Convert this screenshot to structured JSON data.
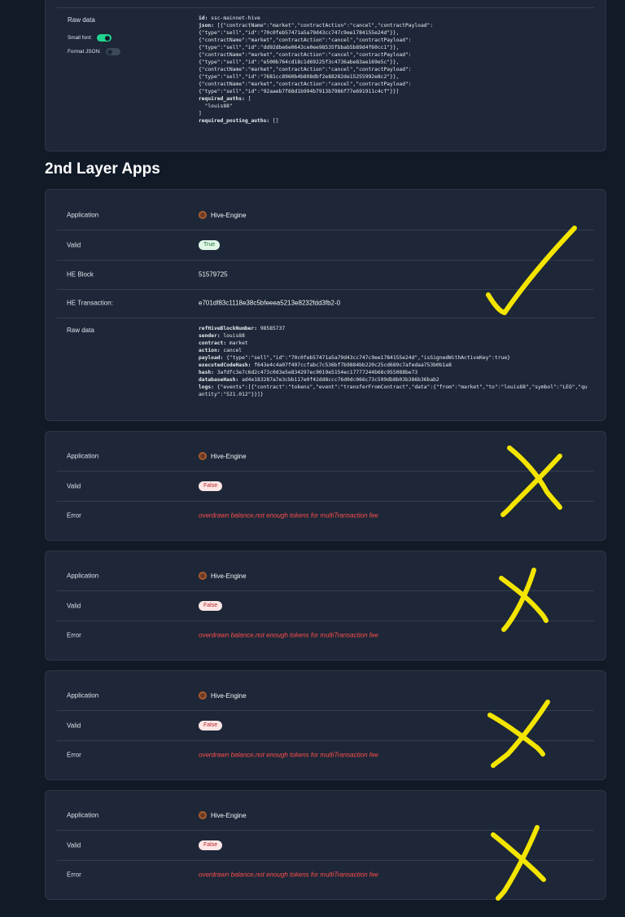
{
  "top": {
    "raw_label": "Raw data",
    "small_font_label": "Small font:",
    "format_json_label": "Format JSON:",
    "json_lines": [
      {
        "k": "id:",
        "v": " ssc-mainnet-hive"
      },
      {
        "k": "json:",
        "v": " [{\"contractName\":\"market\",\"contractAction\":\"cancel\",\"contractPayload\":"
      },
      {
        "k": "",
        "v": "{\"type\":\"sell\",\"id\":\"70c0feb57471a5a79d43cc747c9ee1784155e24d\"}},"
      },
      {
        "k": "",
        "v": "{\"contractName\":\"market\",\"contractAction\":\"cancel\",\"contractPayload\":"
      },
      {
        "k": "",
        "v": "{\"type\":\"sell\",\"id\":\"dd92dbe6e0643ce0ee98535fbbab5b89d4f60cc1\"}},"
      },
      {
        "k": "",
        "v": "{\"contractName\":\"market\",\"contractAction\":\"cancel\",\"contractPayload\":"
      },
      {
        "k": "",
        "v": "{\"type\":\"sell\",\"id\":\"e500b764cd18c1d69225f3c4736abe83ae169e5c\"}},"
      },
      {
        "k": "",
        "v": "{\"contractName\":\"market\",\"contractAction\":\"cancel\",\"contractPayload\":"
      },
      {
        "k": "",
        "v": "{\"type\":\"sell\",\"id\":\"7681cc8960b4b898dbf2e88282de15255992e8c2\"}},"
      },
      {
        "k": "",
        "v": "{\"contractName\":\"market\",\"contractAction\":\"cancel\",\"contractPayload\":"
      },
      {
        "k": "",
        "v": "{\"type\":\"sell\",\"id\":\"92aaeb7f68d1b994b7913b7986f77e691911c4cf\"}}]"
      },
      {
        "k": "required_auths:",
        "v": " ["
      },
      {
        "k": "",
        "v": "  \"louis88\""
      },
      {
        "k": "",
        "v": "]"
      },
      {
        "k": "required_posting_auths:",
        "v": " []"
      }
    ]
  },
  "section_title": "2nd Layer Apps",
  "main": {
    "application_label": "Application",
    "application_value": "Hive-Engine",
    "valid_label": "Valid",
    "valid_value": "True",
    "he_block_label": "HE Block",
    "he_block_value": "51579725",
    "he_tx_label": "HE Transaction:",
    "he_tx_value": "e701df83c1118e38c5bfeeea5213e8232fdd3fb2-0",
    "raw_label": "Raw data",
    "raw_lines": [
      {
        "k": "refHiveBlockNumber:",
        "v": " 98585737"
      },
      {
        "k": "sender:",
        "v": " louis88"
      },
      {
        "k": "contract:",
        "v": " market"
      },
      {
        "k": "action:",
        "v": " cancel"
      },
      {
        "k": "payload:",
        "v": " {\"type\":\"sell\",\"id\":\"70c0feb57471a5a79d43cc747c9ee1784155e24d\",\"isSignedWithActiveKey\":true}"
      },
      {
        "k": "executedCodeHash:",
        "v": " f643e4c4a07f497ccfabc7c536bf7b9884bb220c25cd689c7afedaa753b0b1a8"
      },
      {
        "k": "hash:",
        "v": " 3afdfc3e7c6d2c473c0d3e5e834297ec9019e5154ec17777244b68c955088be73"
      },
      {
        "k": "databaseHash:",
        "v": " ad4e183287a7e3cbb117e0f42dd8ccc76d0dc066c73c599db8b03b386b36bab2"
      },
      {
        "k": "logs:",
        "v": " {\"events\":[{\"contract\":\"tokens\",\"event\":\"transferFromContract\",\"data\":{\"from\":\"market\",\"to\":\"louis88\",\"symbol\":\"LEO\",\"qu"
      },
      {
        "k": "",
        "v": "antity\":\"521.012\"}}]}"
      }
    ]
  },
  "failed": [
    {
      "application_label": "Application",
      "application_value": "Hive-Engine",
      "valid_label": "Valid",
      "valid_value": "False",
      "error_label": "Error",
      "error_value": "overdrawn balance,not enough tokens for multiTransaction fee"
    },
    {
      "application_label": "Application",
      "application_value": "Hive-Engine",
      "valid_label": "Valid",
      "valid_value": "False",
      "error_label": "Error",
      "error_value": "overdrawn balance,not enough tokens for multiTransaction fee"
    },
    {
      "application_label": "Application",
      "application_value": "Hive-Engine",
      "valid_label": "Valid",
      "valid_value": "False",
      "error_label": "Error",
      "error_value": "overdrawn balance,not enough tokens for multiTransaction fee"
    },
    {
      "application_label": "Application",
      "application_value": "Hive-Engine",
      "valid_label": "Valid",
      "valid_value": "False",
      "error_label": "Error",
      "error_value": "overdrawn balance,not enough tokens for multiTransaction fee"
    }
  ],
  "colors": {
    "annotation": "#f4e500",
    "error": "#ff4d4d",
    "toggle_on": "#1fd58f"
  },
  "icons": {
    "app": "hive-engine-logo-icon",
    "check": "checkmark-annotation-icon",
    "cross": "x-annotation-icon"
  }
}
